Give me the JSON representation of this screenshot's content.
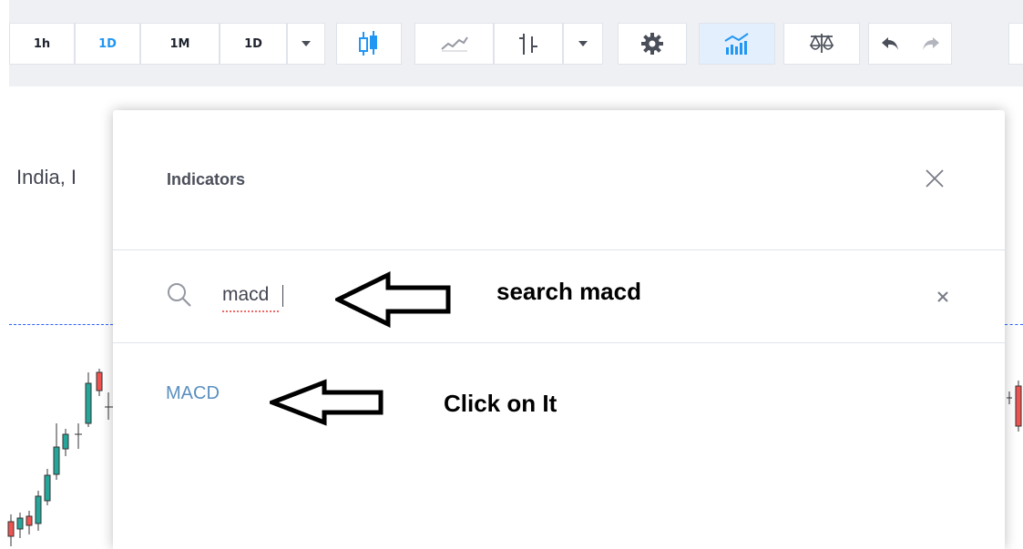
{
  "toolbar": {
    "intervals": [
      {
        "label": "1h",
        "active": false
      },
      {
        "label": "1D",
        "active": true
      },
      {
        "label": "1M",
        "active": false
      },
      {
        "label": "1D",
        "active": false
      }
    ],
    "icons": [
      "chevron-down-icon",
      "candlestick-icon",
      "line-chart-icon",
      "bars-icon",
      "chevron-down-icon",
      "gear-icon",
      "indicators-icon",
      "compare-icon",
      "undo-icon",
      "redo-icon"
    ]
  },
  "chart": {
    "title": "India, I",
    "colors": {
      "up": "#26a69a",
      "down": "#ef5350",
      "price_line": "#2962ff"
    }
  },
  "dialog": {
    "title": "Indicators",
    "search": {
      "value": "macd",
      "placeholder": ""
    },
    "results": [
      {
        "label": "MACD"
      }
    ]
  },
  "annotations": {
    "search_note": "search macd",
    "click_note": "Click on It"
  },
  "colors": {
    "accent": "#2196f3",
    "result_link": "#5a8fbf",
    "toolbar_bg": "#eef0f3"
  }
}
